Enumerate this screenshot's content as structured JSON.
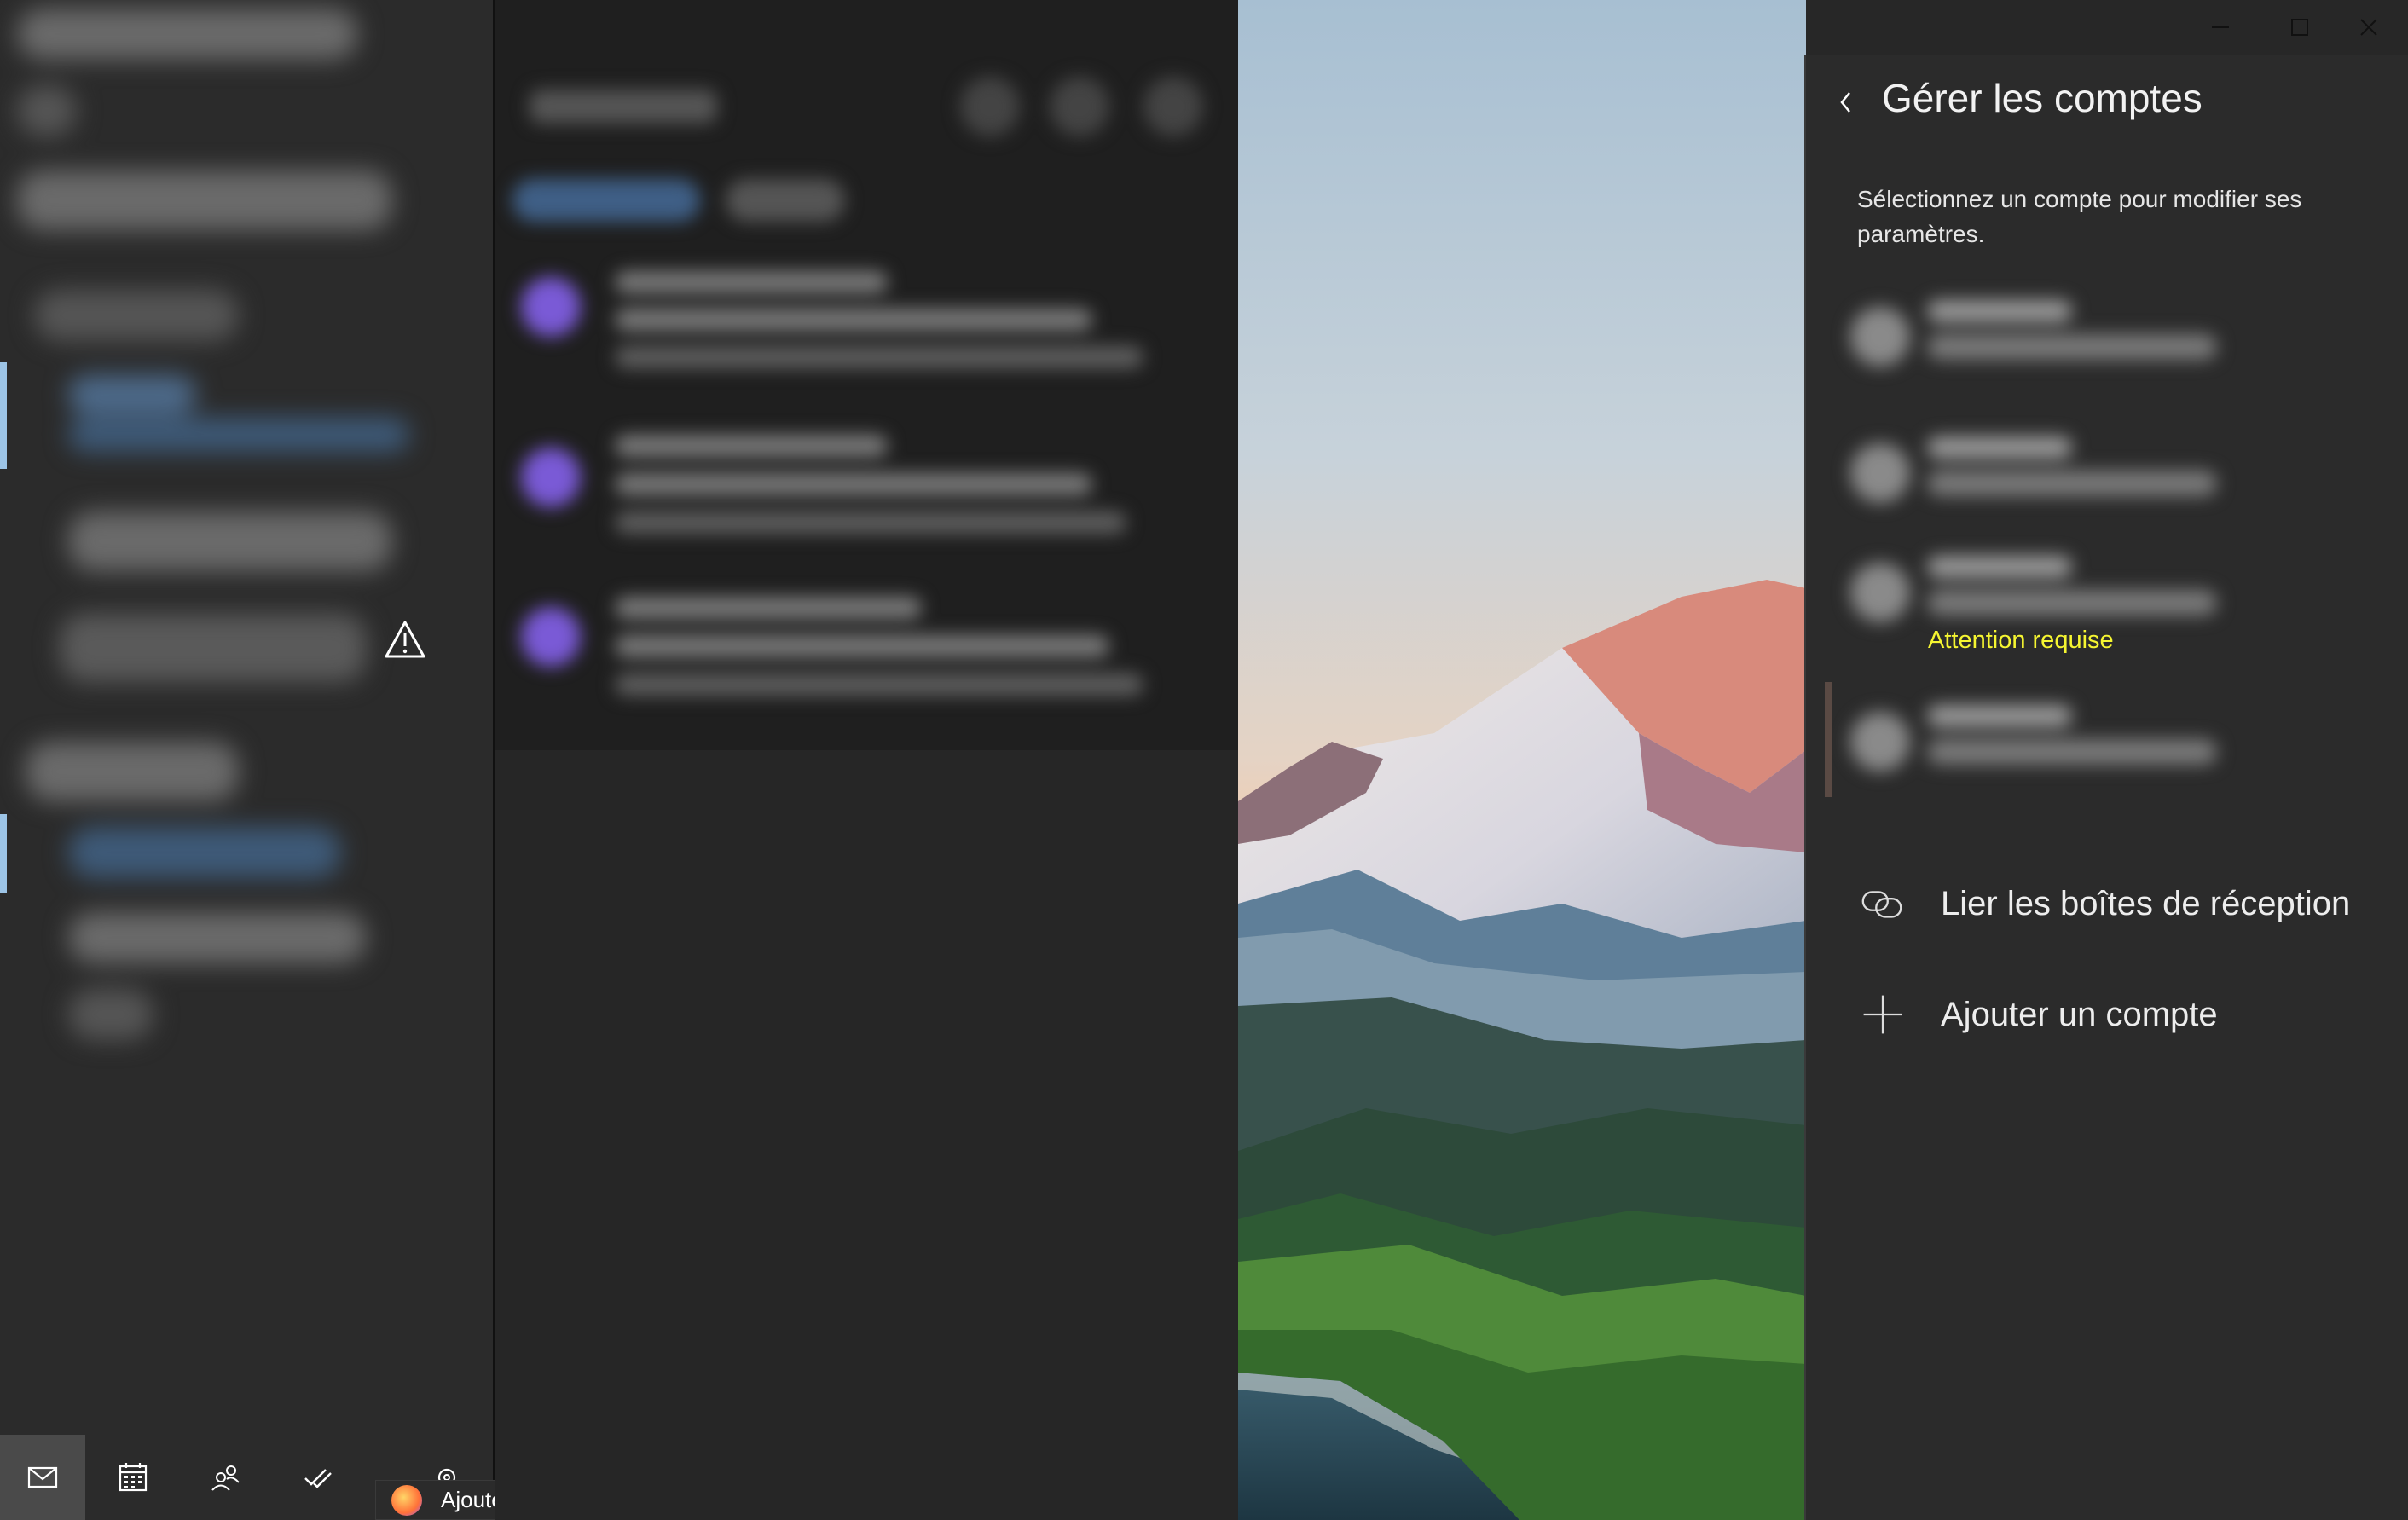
{
  "window": {
    "minimize_icon": "minimize-icon",
    "maximize_icon": "maximize-icon",
    "close_icon": "close-icon"
  },
  "panel": {
    "title": "Gérer les comptes",
    "description": "Sélectionnez un compte pour modifier ses paramètres.",
    "attention_label": "Attention requise",
    "attention_color": "#f5f531",
    "actions": [
      {
        "label": "Lier les boîtes de réception",
        "icon": "link-icon"
      },
      {
        "label": "Ajouter un compte",
        "icon": "plus-icon"
      }
    ]
  },
  "bottom_nav": {
    "icons": [
      "mail-icon",
      "calendar-icon",
      "people-icon",
      "todo-icon",
      "settings-icon"
    ]
  },
  "taskbar_tooltip": {
    "label": "Ajouter un nouvel article ‹ TriBa..."
  },
  "colors": {
    "accent": "#9cc4e6",
    "avatar": "#7a5ad6",
    "panel_bg": "#2b2b2b"
  }
}
